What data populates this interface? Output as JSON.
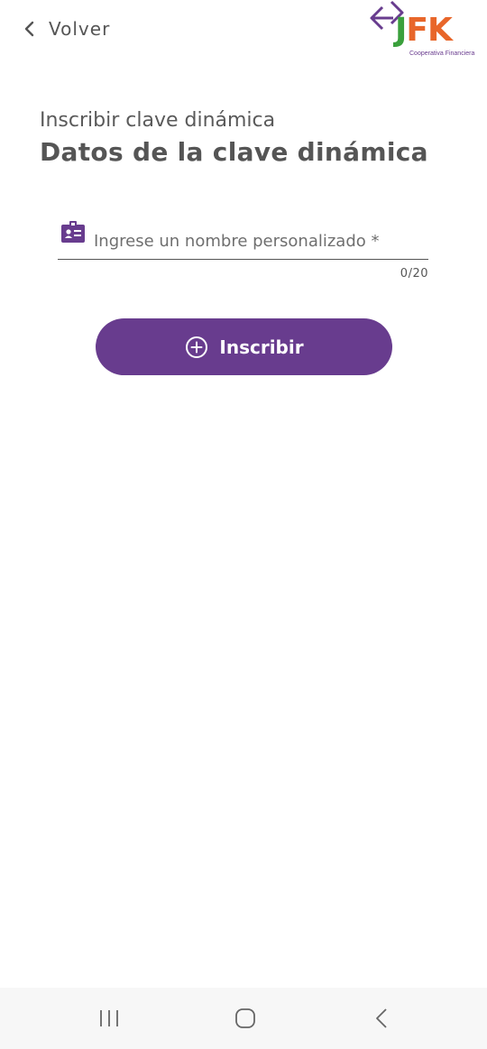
{
  "header": {
    "back_label": "Volver",
    "logo": {
      "letter_j": "J",
      "letters_fk": "FK",
      "tagline": "Cooperativa Financiera",
      "colors": {
        "j": "#3aa03c",
        "fk": "#e8662a",
        "arrows": "#683c8e"
      }
    }
  },
  "form": {
    "subtitle": "Inscribir clave dinámica",
    "title": "Datos de la clave dinámica",
    "name_field": {
      "value": "",
      "placeholder": "Ingrese un nombre personalizado *",
      "icon": "id-card-icon",
      "counter": "0/20"
    },
    "submit": {
      "label": "Inscribir",
      "icon": "plus-circle-icon"
    }
  },
  "system_nav": {
    "recents": "recents-icon",
    "home": "home-icon",
    "back": "back-icon"
  },
  "colors": {
    "accent": "#683c8e",
    "text": "#555555",
    "navbar": "#f7f7f7"
  }
}
